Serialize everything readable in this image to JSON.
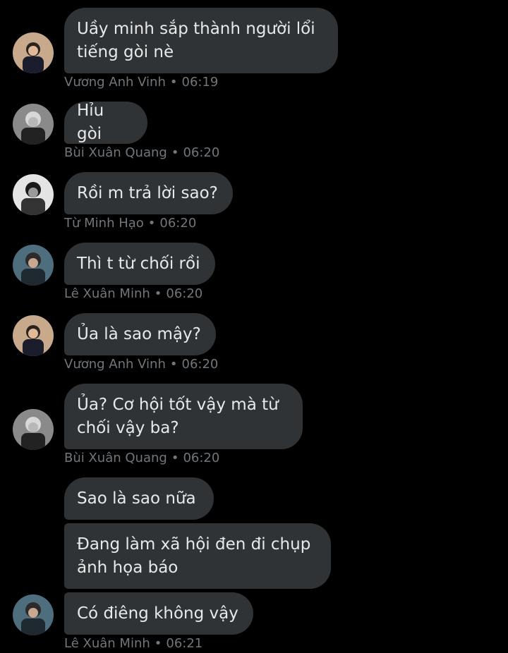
{
  "messages": [
    {
      "text": "Uầy minh sắp thành người lổi tiếng gòi nè",
      "author": "Vương Anh Vinh",
      "time": "06:19"
    },
    {
      "text": "Hỉu gòi",
      "author": "Bùi Xuân Quang",
      "time": "06:20"
    },
    {
      "text": "Rồi m trả lời sao?",
      "author": "Từ Minh Hạo",
      "time": "06:20"
    },
    {
      "text": "Thì t từ chối rồi",
      "author": "Lê Xuân Minh",
      "time": "06:20"
    },
    {
      "text": "Ủa là sao mậy?",
      "author": "Vương Anh Vinh",
      "time": "06:20"
    },
    {
      "text": "Ủa? Cơ hội tốt vậy mà từ chối vậy ba?",
      "author": "Bùi Xuân Quang",
      "time": "06:20"
    },
    {
      "text": "Sao là sao nữa"
    },
    {
      "text": "Đang làm xã hội đen đi chụp ảnh họa báo"
    },
    {
      "text": "Có điêng không vậy",
      "author": "Lê Xuân Minh",
      "time": "06:21"
    }
  ],
  "separator": "•",
  "colors": {
    "background": "#000000",
    "bubble": "#2f3336",
    "text": "#e7e9ea",
    "meta": "#71767b"
  }
}
